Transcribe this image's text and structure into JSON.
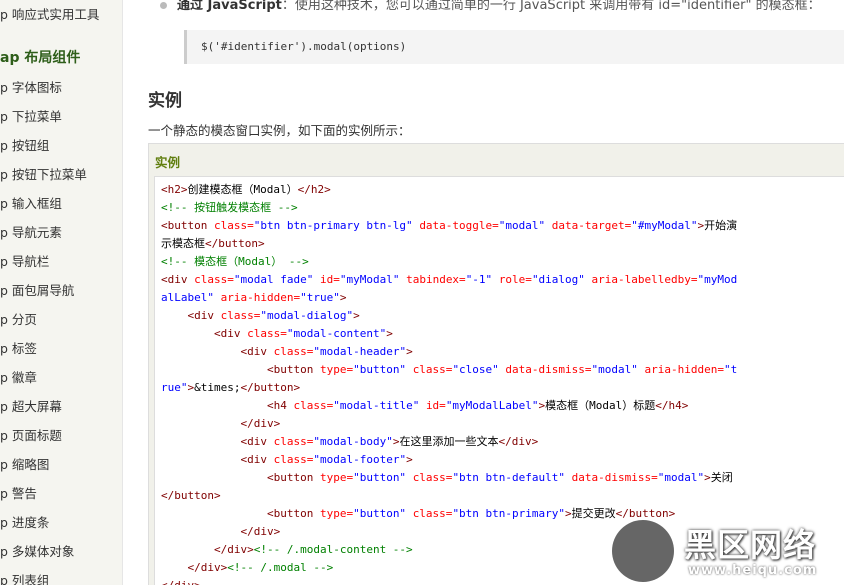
{
  "sidebar": {
    "top_item": "p 响应式实用工具",
    "section_header": "ap 布局组件",
    "items": [
      "p 字体图标",
      "p 下拉菜单",
      "p 按钮组",
      "p 按钮下拉菜单",
      "p 输入框组",
      "p 导航元素",
      "p 导航栏",
      "p 面包屑导航",
      "p 分页",
      "p 标签",
      "p 徽章",
      "p 超大屏幕",
      "p 页面标题",
      "p 缩略图",
      "p 警告",
      "p 进度条",
      "p 多媒体对象",
      "p 列表组"
    ]
  },
  "main": {
    "bullet_bold": "通过 JavaScript",
    "bullet_text": "：使用这种技术，您可以通过简单的一行 JavaScript 来调用带有 id=\"identifier\" 的模态框：",
    "snippet": "$('#identifier').modal(options)",
    "section_title": "实例",
    "intro": "一个静态的模态窗口实例，如下面的实例所示：",
    "example_label": "实例"
  },
  "code_lines": [
    [
      [
        "t",
        "<h2>"
      ],
      [
        "x",
        "创建模态框（Modal）"
      ],
      [
        "t",
        "</h2>"
      ]
    ],
    [
      [
        "c",
        "<!-- 按钮触发模态框 -->"
      ]
    ],
    [
      [
        "t",
        "<button "
      ],
      [
        "a",
        "class="
      ],
      [
        "v",
        "\"btn btn-primary btn-lg\" "
      ],
      [
        "a",
        "data-toggle="
      ],
      [
        "v",
        "\"modal\" "
      ],
      [
        "a",
        "data-target="
      ],
      [
        "v",
        "\"#myModal\""
      ],
      [
        "t",
        ">"
      ],
      [
        "x",
        "开始演"
      ]
    ],
    [
      [
        "x",
        "示模态框"
      ],
      [
        "t",
        "</button>"
      ]
    ],
    [
      [
        "c",
        "<!-- 模态框（Modal） -->"
      ]
    ],
    [
      [
        "t",
        "<div "
      ],
      [
        "a",
        "class="
      ],
      [
        "v",
        "\"modal fade\" "
      ],
      [
        "a",
        "id="
      ],
      [
        "v",
        "\"myModal\" "
      ],
      [
        "a",
        "tabindex="
      ],
      [
        "v",
        "\"-1\" "
      ],
      [
        "a",
        "role="
      ],
      [
        "v",
        "\"dialog\" "
      ],
      [
        "a",
        "aria-labelledby="
      ],
      [
        "v",
        "\"myMod"
      ]
    ],
    [
      [
        "v",
        "alLabel\" "
      ],
      [
        "a",
        "aria-hidden="
      ],
      [
        "v",
        "\"true\""
      ],
      [
        "t",
        ">"
      ]
    ],
    [
      [
        "x",
        "    "
      ],
      [
        "t",
        "<div "
      ],
      [
        "a",
        "class="
      ],
      [
        "v",
        "\"modal-dialog\""
      ],
      [
        "t",
        ">"
      ]
    ],
    [
      [
        "x",
        "        "
      ],
      [
        "t",
        "<div "
      ],
      [
        "a",
        "class="
      ],
      [
        "v",
        "\"modal-content\""
      ],
      [
        "t",
        ">"
      ]
    ],
    [
      [
        "x",
        "            "
      ],
      [
        "t",
        "<div "
      ],
      [
        "a",
        "class="
      ],
      [
        "v",
        "\"modal-header\""
      ],
      [
        "t",
        ">"
      ]
    ],
    [
      [
        "x",
        "                "
      ],
      [
        "t",
        "<button "
      ],
      [
        "a",
        "type="
      ],
      [
        "v",
        "\"button\" "
      ],
      [
        "a",
        "class="
      ],
      [
        "v",
        "\"close\" "
      ],
      [
        "a",
        "data-dismiss="
      ],
      [
        "v",
        "\"modal\" "
      ],
      [
        "a",
        "aria-hidden="
      ],
      [
        "v",
        "\"t"
      ]
    ],
    [
      [
        "v",
        "rue\""
      ],
      [
        "t",
        ">"
      ],
      [
        "x",
        "&times;"
      ],
      [
        "t",
        "</button>"
      ]
    ],
    [
      [
        "x",
        "                "
      ],
      [
        "t",
        "<h4 "
      ],
      [
        "a",
        "class="
      ],
      [
        "v",
        "\"modal-title\" "
      ],
      [
        "a",
        "id="
      ],
      [
        "v",
        "\"myModalLabel\""
      ],
      [
        "t",
        ">"
      ],
      [
        "x",
        "模态框（Modal）标题"
      ],
      [
        "t",
        "</h4>"
      ]
    ],
    [
      [
        "x",
        "            "
      ],
      [
        "t",
        "</div>"
      ]
    ],
    [
      [
        "x",
        "            "
      ],
      [
        "t",
        "<div "
      ],
      [
        "a",
        "class="
      ],
      [
        "v",
        "\"modal-body\""
      ],
      [
        "t",
        ">"
      ],
      [
        "x",
        "在这里添加一些文本"
      ],
      [
        "t",
        "</div>"
      ]
    ],
    [
      [
        "x",
        "            "
      ],
      [
        "t",
        "<div "
      ],
      [
        "a",
        "class="
      ],
      [
        "v",
        "\"modal-footer\""
      ],
      [
        "t",
        ">"
      ]
    ],
    [
      [
        "x",
        "                "
      ],
      [
        "t",
        "<button "
      ],
      [
        "a",
        "type="
      ],
      [
        "v",
        "\"button\" "
      ],
      [
        "a",
        "class="
      ],
      [
        "v",
        "\"btn btn-default\" "
      ],
      [
        "a",
        "data-dismiss="
      ],
      [
        "v",
        "\"modal\""
      ],
      [
        "t",
        ">"
      ],
      [
        "x",
        "关闭"
      ]
    ],
    [
      [
        "t",
        "</button>"
      ]
    ],
    [
      [
        "x",
        "                "
      ],
      [
        "t",
        "<button "
      ],
      [
        "a",
        "type="
      ],
      [
        "v",
        "\"button\" "
      ],
      [
        "a",
        "class="
      ],
      [
        "v",
        "\"btn btn-primary\""
      ],
      [
        "t",
        ">"
      ],
      [
        "x",
        "提交更改"
      ],
      [
        "t",
        "</button>"
      ]
    ],
    [
      [
        "x",
        "            "
      ],
      [
        "t",
        "</div>"
      ]
    ],
    [
      [
        "x",
        "        "
      ],
      [
        "t",
        "</div>"
      ],
      [
        "c",
        "<!-- /.modal-content -->"
      ]
    ],
    [
      [
        "x",
        "    "
      ],
      [
        "t",
        "</div>"
      ],
      [
        "c",
        "<!-- /.modal -->"
      ]
    ],
    [
      [
        "t",
        "</div>"
      ]
    ]
  ],
  "watermark": {
    "text": "黑区网络",
    "url": "www.heiqu.com"
  }
}
